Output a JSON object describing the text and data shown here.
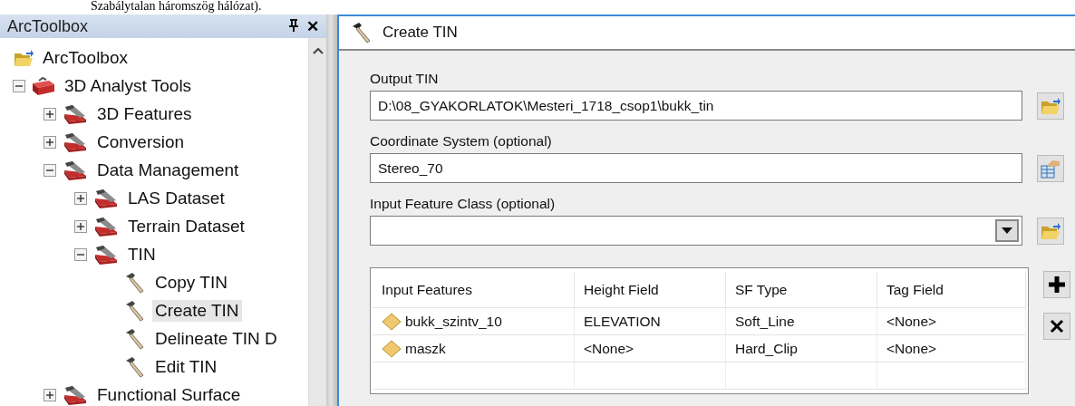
{
  "document_line": "Szabálytalan háromszög hálózat).",
  "toolbox_panel": {
    "title": "ArcToolbox",
    "close": "✕",
    "tree": [
      {
        "label": "ArcToolbox",
        "kind": "root",
        "selected": false,
        "children": [
          {
            "label": "3D Analyst Tools",
            "kind": "toolbox",
            "expanded": true,
            "selected": false,
            "children": [
              {
                "label": "3D Features",
                "kind": "toolset",
                "expanded": false,
                "selected": false
              },
              {
                "label": "Conversion",
                "kind": "toolset",
                "expanded": false,
                "selected": false
              },
              {
                "label": "Data Management",
                "kind": "toolset",
                "expanded": true,
                "selected": false,
                "children": [
                  {
                    "label": "LAS Dataset",
                    "kind": "toolset",
                    "expanded": false,
                    "selected": false
                  },
                  {
                    "label": "Terrain Dataset",
                    "kind": "toolset",
                    "expanded": false,
                    "selected": false
                  },
                  {
                    "label": "TIN",
                    "kind": "toolset",
                    "expanded": true,
                    "selected": false,
                    "children": [
                      {
                        "label": "Copy TIN",
                        "kind": "tool",
                        "selected": false
                      },
                      {
                        "label": "Create TIN",
                        "kind": "tool",
                        "selected": true
                      },
                      {
                        "label": "Delineate TIN D",
                        "kind": "tool",
                        "selected": false
                      },
                      {
                        "label": "Edit TIN",
                        "kind": "tool",
                        "selected": false
                      }
                    ]
                  }
                ]
              },
              {
                "label": "Functional Surface",
                "kind": "toolset",
                "expanded": false,
                "selected": false
              }
            ]
          }
        ]
      }
    ]
  },
  "dialog": {
    "title": "Create TIN",
    "fields": [
      {
        "label": "Output TIN",
        "kind": "text",
        "value": "D:\\08_GYAKORLATOK\\Mesteri_1718_csop1\\bukk_tin",
        "button": {
          "kind": "browse"
        }
      },
      {
        "label": "Coordinate System (optional)",
        "kind": "text",
        "value": "Stereo_70",
        "button": {
          "kind": "properties"
        }
      },
      {
        "label": "Input Feature Class (optional)",
        "kind": "combo",
        "button": {
          "kind": "browse"
        }
      }
    ],
    "table": {
      "columns": [
        "Input Features",
        "Height Field",
        "SF Type",
        "Tag Field"
      ],
      "rows": [
        [
          "bukk_szintv_10",
          "ELEVATION",
          "Soft_Line",
          "<None>"
        ],
        [
          "maszk",
          "<None>",
          "Hard_Clip",
          "<None>"
        ]
      ]
    },
    "side_buttons": [
      {
        "kind": "add"
      },
      {
        "kind": "remove"
      }
    ]
  }
}
